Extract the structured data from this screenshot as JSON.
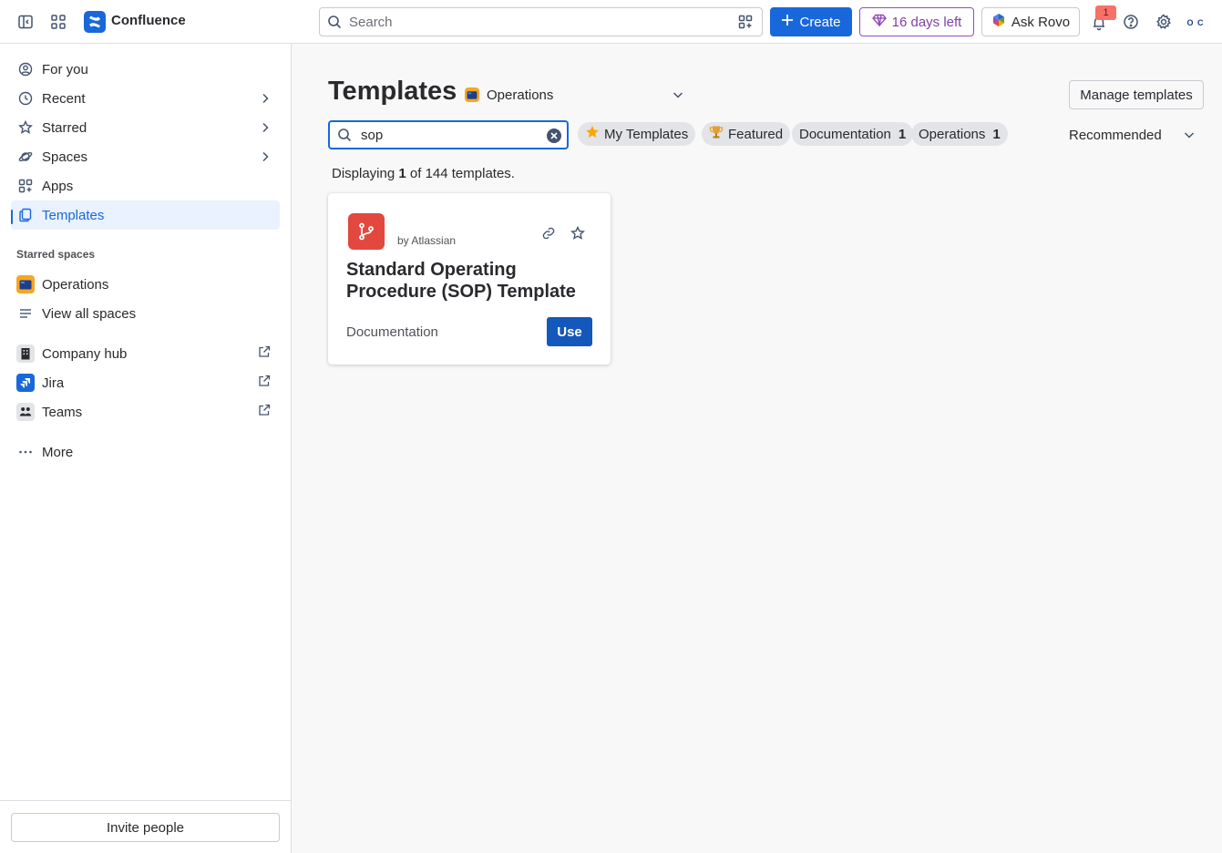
{
  "app": {
    "name": "Confluence"
  },
  "topbar": {
    "search_placeholder": "Search",
    "create_label": "Create",
    "trial_label": "16 days left",
    "rovo_label": "Ask Rovo",
    "notification_count": "1",
    "avatar_initials": "O C"
  },
  "sidebar": {
    "nav": [
      {
        "label": "For you"
      },
      {
        "label": "Recent"
      },
      {
        "label": "Starred"
      },
      {
        "label": "Spaces"
      },
      {
        "label": "Apps"
      },
      {
        "label": "Templates"
      }
    ],
    "starred_spaces_label": "Starred spaces",
    "spaces": [
      {
        "label": "Operations"
      },
      {
        "label": "View all spaces"
      }
    ],
    "links": [
      {
        "label": "Company hub"
      },
      {
        "label": "Jira"
      },
      {
        "label": "Teams"
      }
    ],
    "more_label": "More",
    "invite_label": "Invite people"
  },
  "main": {
    "title": "Templates",
    "space_selected": "Operations",
    "manage_label": "Manage templates",
    "search_value": "sop",
    "chips": [
      {
        "label": "My Templates",
        "count": ""
      },
      {
        "label": "Featured",
        "count": ""
      },
      {
        "label": "Documentation",
        "count": "1"
      },
      {
        "label": "Operations",
        "count": "1"
      }
    ],
    "sort_label": "Recommended",
    "count_prefix": "Displaying",
    "count_shown": "1",
    "count_suffix": "of 144 templates.",
    "card": {
      "by": "by Atlassian",
      "title": "Standard Operating Procedure (SOP) Template",
      "category": "Documentation",
      "use_label": "Use"
    }
  },
  "colors": {
    "accent": "#1868DB",
    "trial": "#964AC0",
    "template_icon": "#E2483D",
    "space_tile": "#F5A623"
  }
}
